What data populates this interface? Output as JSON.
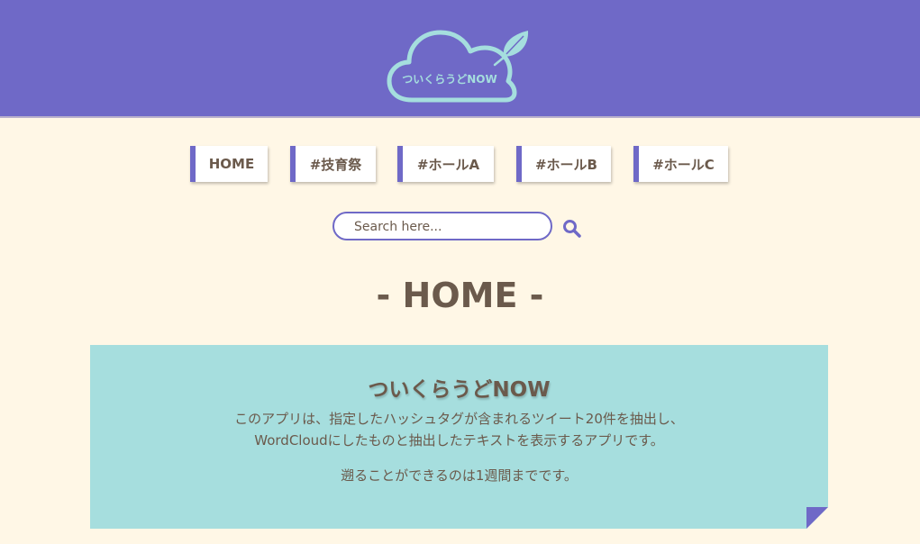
{
  "header": {
    "logo_text": "ついくらうどNOW",
    "bg_color": "#6f69c7",
    "logo_color": "#a5dede"
  },
  "nav": {
    "items": [
      {
        "label": "HOME"
      },
      {
        "label": "#技育祭"
      },
      {
        "label": "#ホールA"
      },
      {
        "label": "#ホールB"
      },
      {
        "label": "#ホールC"
      }
    ]
  },
  "search": {
    "placeholder": "Search here..."
  },
  "main": {
    "page_title": "- HOME -",
    "card": {
      "title": "ついくらうどNOW",
      "line1": "このアプリは、指定したハッシュタグが含まれるツイート20件を抽出し、",
      "line2": "WordCloudにしたものと抽出したテキストを表示するアプリです。",
      "line3": "遡ることができるのは1週間までです。"
    }
  },
  "colors": {
    "background": "#fff7e6",
    "accent": "#6f69c7",
    "card": "#a6dede",
    "text": "#6b5a4c"
  }
}
